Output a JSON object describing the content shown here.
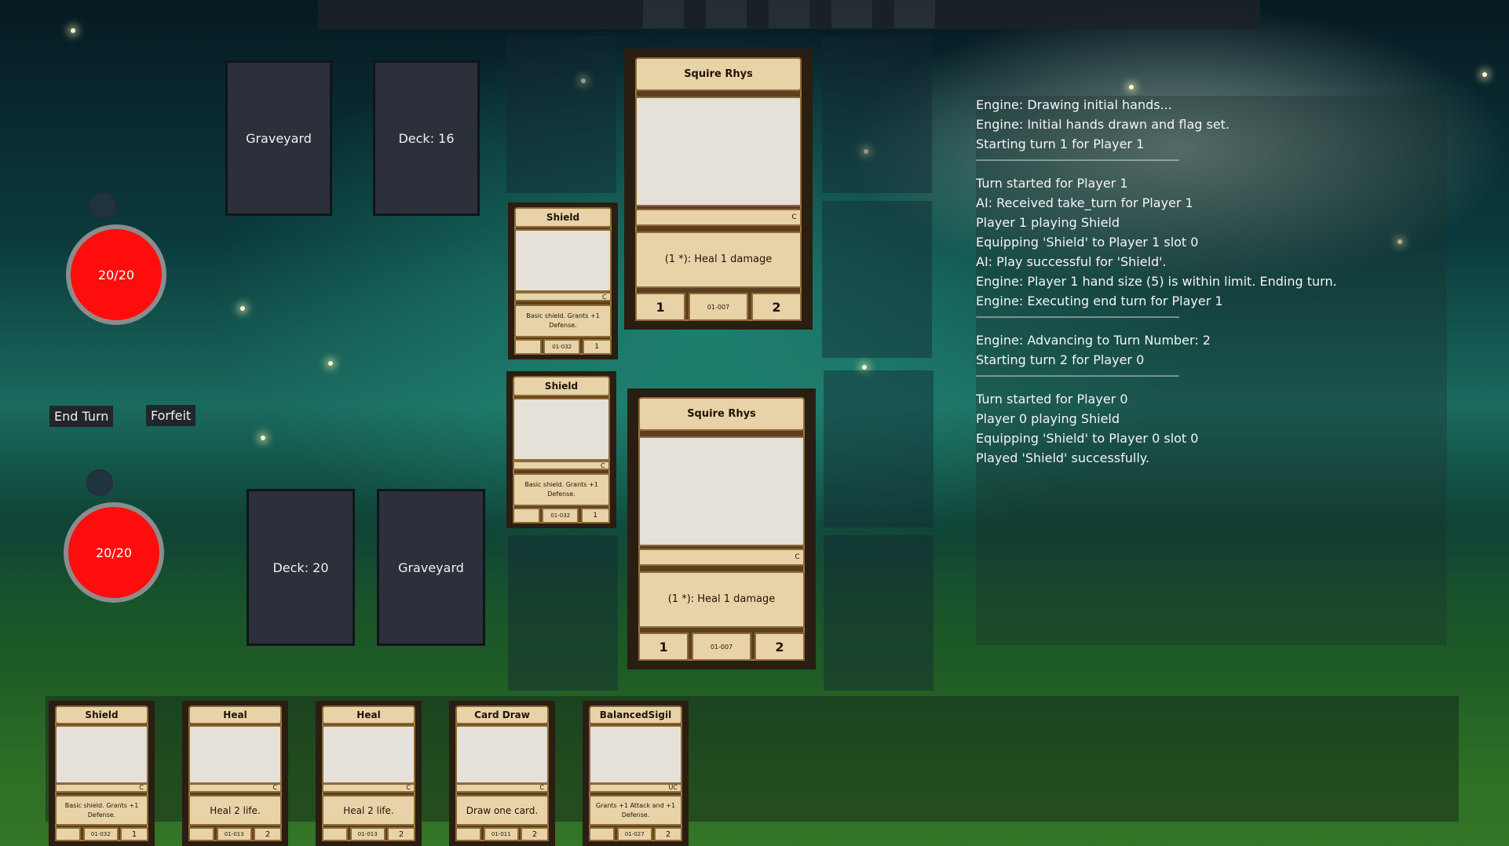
{
  "piles": {
    "p1_graveyard": "Graveyard",
    "p1_deck": "Deck: 16",
    "p0_deck": "Deck: 20",
    "p0_graveyard": "Graveyard"
  },
  "life": {
    "p1": "20/20",
    "p0": "20/20"
  },
  "buttons": {
    "end_turn": "End Turn",
    "forfeit": "Forfeit"
  },
  "board": {
    "p1_creature": {
      "name": "Squire Rhys",
      "rarity": "C",
      "text": "(1 *): Heal 1 damage",
      "attack": "1",
      "code": "01-007",
      "defense": "2"
    },
    "p0_creature": {
      "name": "Squire Rhys",
      "rarity": "C",
      "text": "(1 *): Heal 1 damage",
      "attack": "1",
      "code": "01-007",
      "defense": "2"
    },
    "p1_equipment": {
      "name": "Shield",
      "rarity": "C",
      "text": "Basic shield. Grants +1 Defense.",
      "code": "01-032",
      "cost": "1"
    },
    "p0_equipment": {
      "name": "Shield",
      "rarity": "C",
      "text": "Basic shield. Grants +1 Defense.",
      "code": "01-032",
      "cost": "1"
    }
  },
  "hand": [
    {
      "name": "Shield",
      "rarity": "C",
      "text": "Basic shield. Grants +1 Defense.",
      "code": "01-032",
      "cost": "1"
    },
    {
      "name": "Heal",
      "rarity": "C",
      "text": "Heal 2 life.",
      "code": "01-013",
      "cost": "2"
    },
    {
      "name": "Heal",
      "rarity": "C",
      "text": "Heal 2 life.",
      "code": "01-013",
      "cost": "2"
    },
    {
      "name": "Card Draw",
      "rarity": "C",
      "text": "Draw one card.",
      "code": "01-011",
      "cost": "2"
    },
    {
      "name": "BalancedSigil",
      "rarity": "UC",
      "text": "Grants +1 Attack and +1 Defense.",
      "code": "01-027",
      "cost": "2"
    }
  ],
  "log": [
    "Engine: Drawing initial hands...",
    "Engine: Initial hands drawn and flag set.",
    "Starting turn 1 for Player 1",
    "---------------------------------------------------------------------------------------",
    "Turn started for Player 1",
    "AI: Received take_turn for Player 1",
    "Player 1 playing Shield",
    "Equipping 'Shield' to Player 1 slot 0",
    "AI: Play successful for 'Shield'.",
    "Engine: Player 1 hand size (5) is within limit. Ending turn.",
    "Engine: Executing end turn for Player 1",
    "---------------------------------------------------------------------------------------",
    "Engine: Advancing to Turn Number: 2",
    "Starting turn 2 for Player 0",
    "---------------------------------------------------------------------------------------",
    "Turn started for Player 0",
    "Player 0 playing Shield",
    "Equipping 'Shield' to Player 0 slot 0",
    "Played 'Shield' successfully."
  ]
}
